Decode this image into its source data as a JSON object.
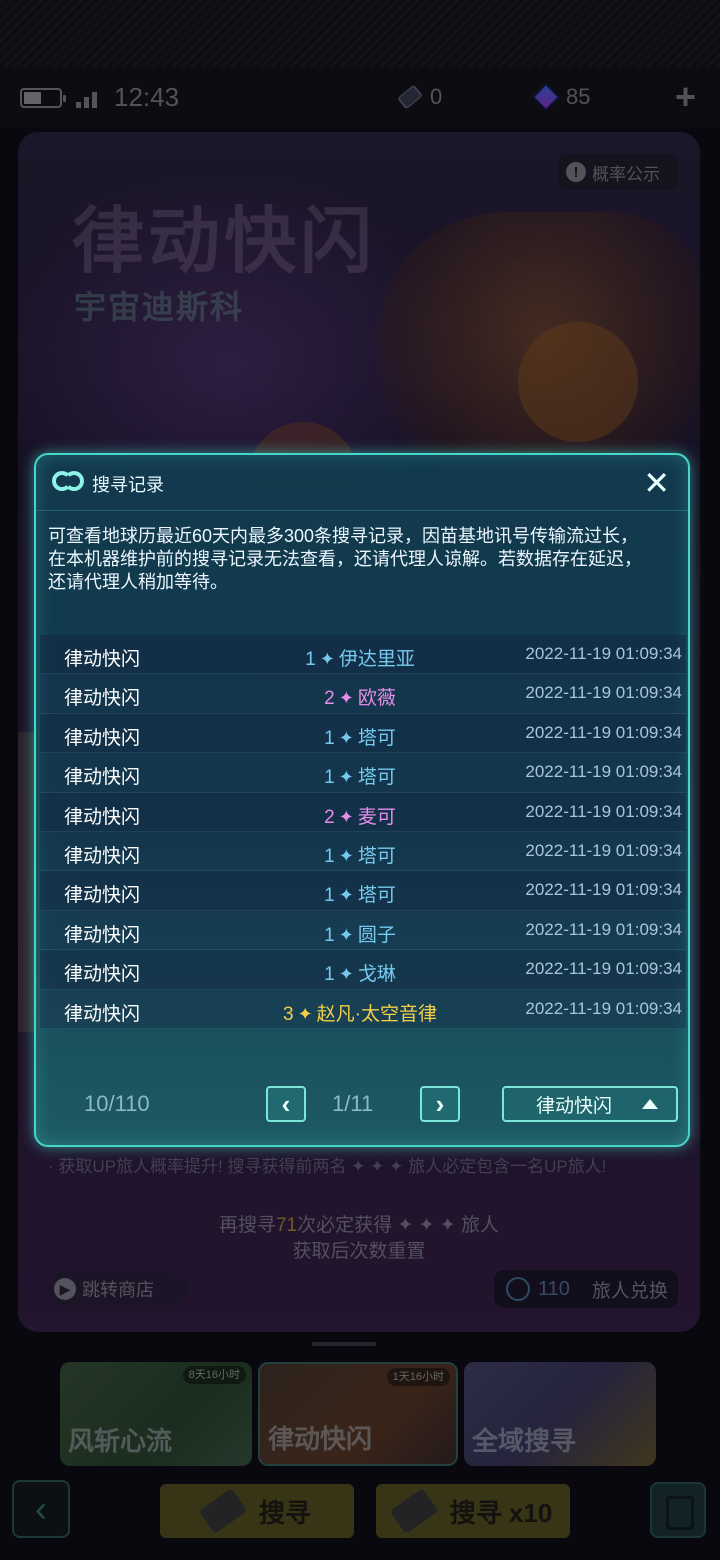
{
  "status": {
    "time": "12:43",
    "battery_level": 0.5,
    "tickets": "0",
    "crystals": "85"
  },
  "banner": {
    "title": "律动快闪",
    "subtitle": "宇宙迪斯科",
    "prob_label": "概率公示",
    "up_note": "· 获取UP旅人概率提升!  搜寻获得前两名 ✦ ✦ ✦ 旅人必定包含一名UP旅人!",
    "pity_prefix": "再搜寻",
    "pity_num": "71",
    "pity_suffix": "次必定获得 ✦ ✦ ✦ 旅人",
    "pity_line2": "获取后次数重置",
    "jump_label": "跳转商店",
    "exchange_count": "110",
    "exchange_label": "旅人兑换"
  },
  "cards": [
    {
      "label": "风斩心流",
      "timer": "8天16小时"
    },
    {
      "label": "律动快闪",
      "timer": "1天16小时"
    },
    {
      "label": "全域搜寻",
      "timer": ""
    }
  ],
  "bottom": {
    "search1_label": "搜寻",
    "search10_label": "搜寻  x10",
    "back_icon": "chevron-left-icon"
  },
  "modal": {
    "title": "搜寻记录",
    "close": "✕",
    "desc": [
      "可查看地球历最近60天内最多300条搜寻记录，因苗基地讯号传输流过长，",
      "在本机器维护前的搜寻记录无法查看，还请代理人谅解。若数据存在延迟，",
      "还请代理人稍加等待。"
    ],
    "records": [
      {
        "pool": "律动快闪",
        "rarity": "1",
        "name": "伊达里亚",
        "time": "2022-11-19 01:09:34"
      },
      {
        "pool": "律动快闪",
        "rarity": "2",
        "name": "欧薇",
        "time": "2022-11-19 01:09:34"
      },
      {
        "pool": "律动快闪",
        "rarity": "1",
        "name": "塔可",
        "time": "2022-11-19 01:09:34"
      },
      {
        "pool": "律动快闪",
        "rarity": "1",
        "name": "塔可",
        "time": "2022-11-19 01:09:34"
      },
      {
        "pool": "律动快闪",
        "rarity": "2",
        "name": "麦可",
        "time": "2022-11-19 01:09:34"
      },
      {
        "pool": "律动快闪",
        "rarity": "1",
        "name": "塔可",
        "time": "2022-11-19 01:09:34"
      },
      {
        "pool": "律动快闪",
        "rarity": "1",
        "name": "塔可",
        "time": "2022-11-19 01:09:34"
      },
      {
        "pool": "律动快闪",
        "rarity": "1",
        "name": "圆子",
        "time": "2022-11-19 01:09:34"
      },
      {
        "pool": "律动快闪",
        "rarity": "1",
        "name": "戈琳",
        "time": "2022-11-19 01:09:34"
      },
      {
        "pool": "律动快闪",
        "rarity": "3",
        "name": "赵凡·太空音律",
        "time": "2022-11-19 01:09:34"
      }
    ],
    "count": "10/110",
    "page": "1/11",
    "prev": "‹",
    "next": "›",
    "filter": "律动快闪"
  },
  "colors": {
    "rarity1": "#75c9ef",
    "rarity2": "#e58ce8",
    "rarity3": "#f3cf46",
    "accent": "#46d6c9"
  }
}
